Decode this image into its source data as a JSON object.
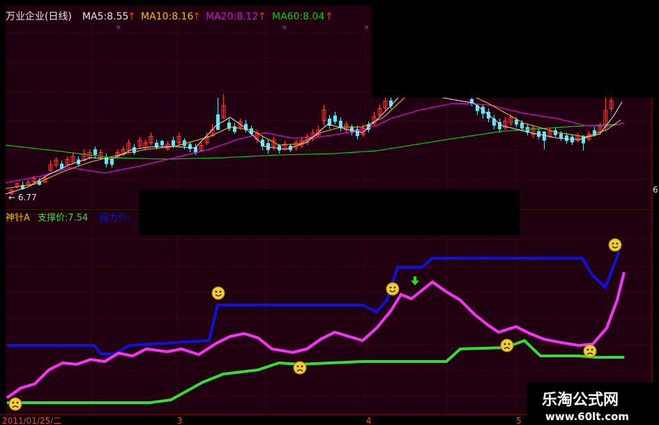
{
  "colors": {
    "background": "#200010",
    "grid": "#6a0000",
    "up_candle": "#ff3b3b",
    "down_candle": "#5fe6f6",
    "ma5": "#e0e0e0",
    "ma10": "#f0c000",
    "ma20": "#e000e0",
    "ma60": "#00c800",
    "resistance": "#1010e0",
    "momentum": "#ff30ff",
    "support": "#30e030"
  },
  "upper_panel": {
    "stock_name": "万业企业(日线)",
    "ma5_label": "MA5:8.55",
    "ma10_label": "MA10:8.16",
    "ma20_label": "MA20:8.12",
    "ma60_label": "MA60:8.04",
    "up_arrow": "↑",
    "low_marker": "← 6.77",
    "right_edge_label": "6"
  },
  "lower_panel": {
    "indicator_name": "神针A",
    "support_label": "支撑价:7.54",
    "resistance_label_partial": "阻力价:"
  },
  "x_axis": {
    "date_label": "2011/01/25/二",
    "month_labels": [
      "3",
      "4",
      "5"
    ]
  },
  "watermark": {
    "title": "乐淘公式网",
    "url": "www.60lt.com"
  },
  "icons": {
    "smile": "smiley-face-icon",
    "sad": "sad-face-icon",
    "down_arrow": "green-down-arrow-icon"
  }
}
